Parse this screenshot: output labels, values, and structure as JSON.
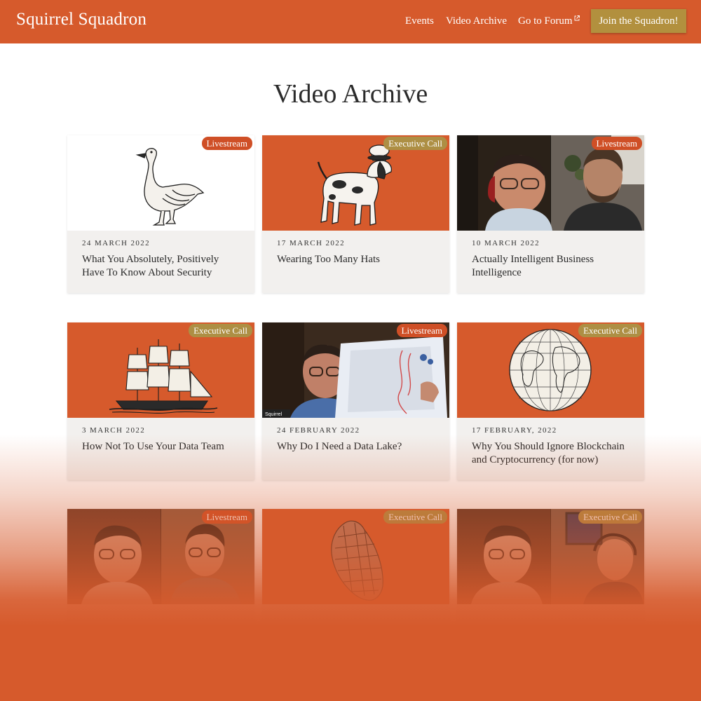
{
  "nav": {
    "brand": "Squirrel Squadron",
    "links": [
      "Events",
      "Video Archive",
      "Go to Forum"
    ],
    "cta": "Join the Squadron!"
  },
  "page": {
    "title": "Video Archive"
  },
  "colors": {
    "brand": "#d65a2c",
    "cta": "#b2903e",
    "livestream_badge": "#cf4f26",
    "executive_badge": "#ad8f44",
    "card_bg": "#f2f0ee"
  },
  "videos": [
    {
      "badge": "Livestream",
      "date": "24 MARCH 2022",
      "title": "What You Absolutely, Positively Have To Know About Security",
      "thumb": "goose illustration"
    },
    {
      "badge": "Executive Call",
      "date": "17 MARCH 2022",
      "title": "Wearing Too Many Hats",
      "thumb": "dog with hats illustration"
    },
    {
      "badge": "Livestream",
      "date": "10 MARCH 2022",
      "title": "Actually Intelligent Business Intelligence",
      "thumb": "video call screenshot"
    },
    {
      "badge": "Executive Call",
      "date": "3 MARCH 2022",
      "title": "How Not To Use Your Data Team",
      "thumb": "sailing ship illustration"
    },
    {
      "badge": "Livestream",
      "date": "24 FEBRUARY 2022",
      "title": "Why Do I Need a Data Lake?",
      "thumb": "whiteboard video call",
      "caption": "Squirrel"
    },
    {
      "badge": "Executive Call",
      "date": "17 FEBRUARY, 2022",
      "title": "Why You Should Ignore Blockchain and Cryptocurrency (for now)",
      "thumb": "globe illustration"
    },
    {
      "badge": "Livestream",
      "thumb": "video call screenshot"
    },
    {
      "badge": "Executive Call",
      "thumb": "pine cone illustration"
    },
    {
      "badge": "Executive Call",
      "thumb": "video call screenshot"
    }
  ]
}
